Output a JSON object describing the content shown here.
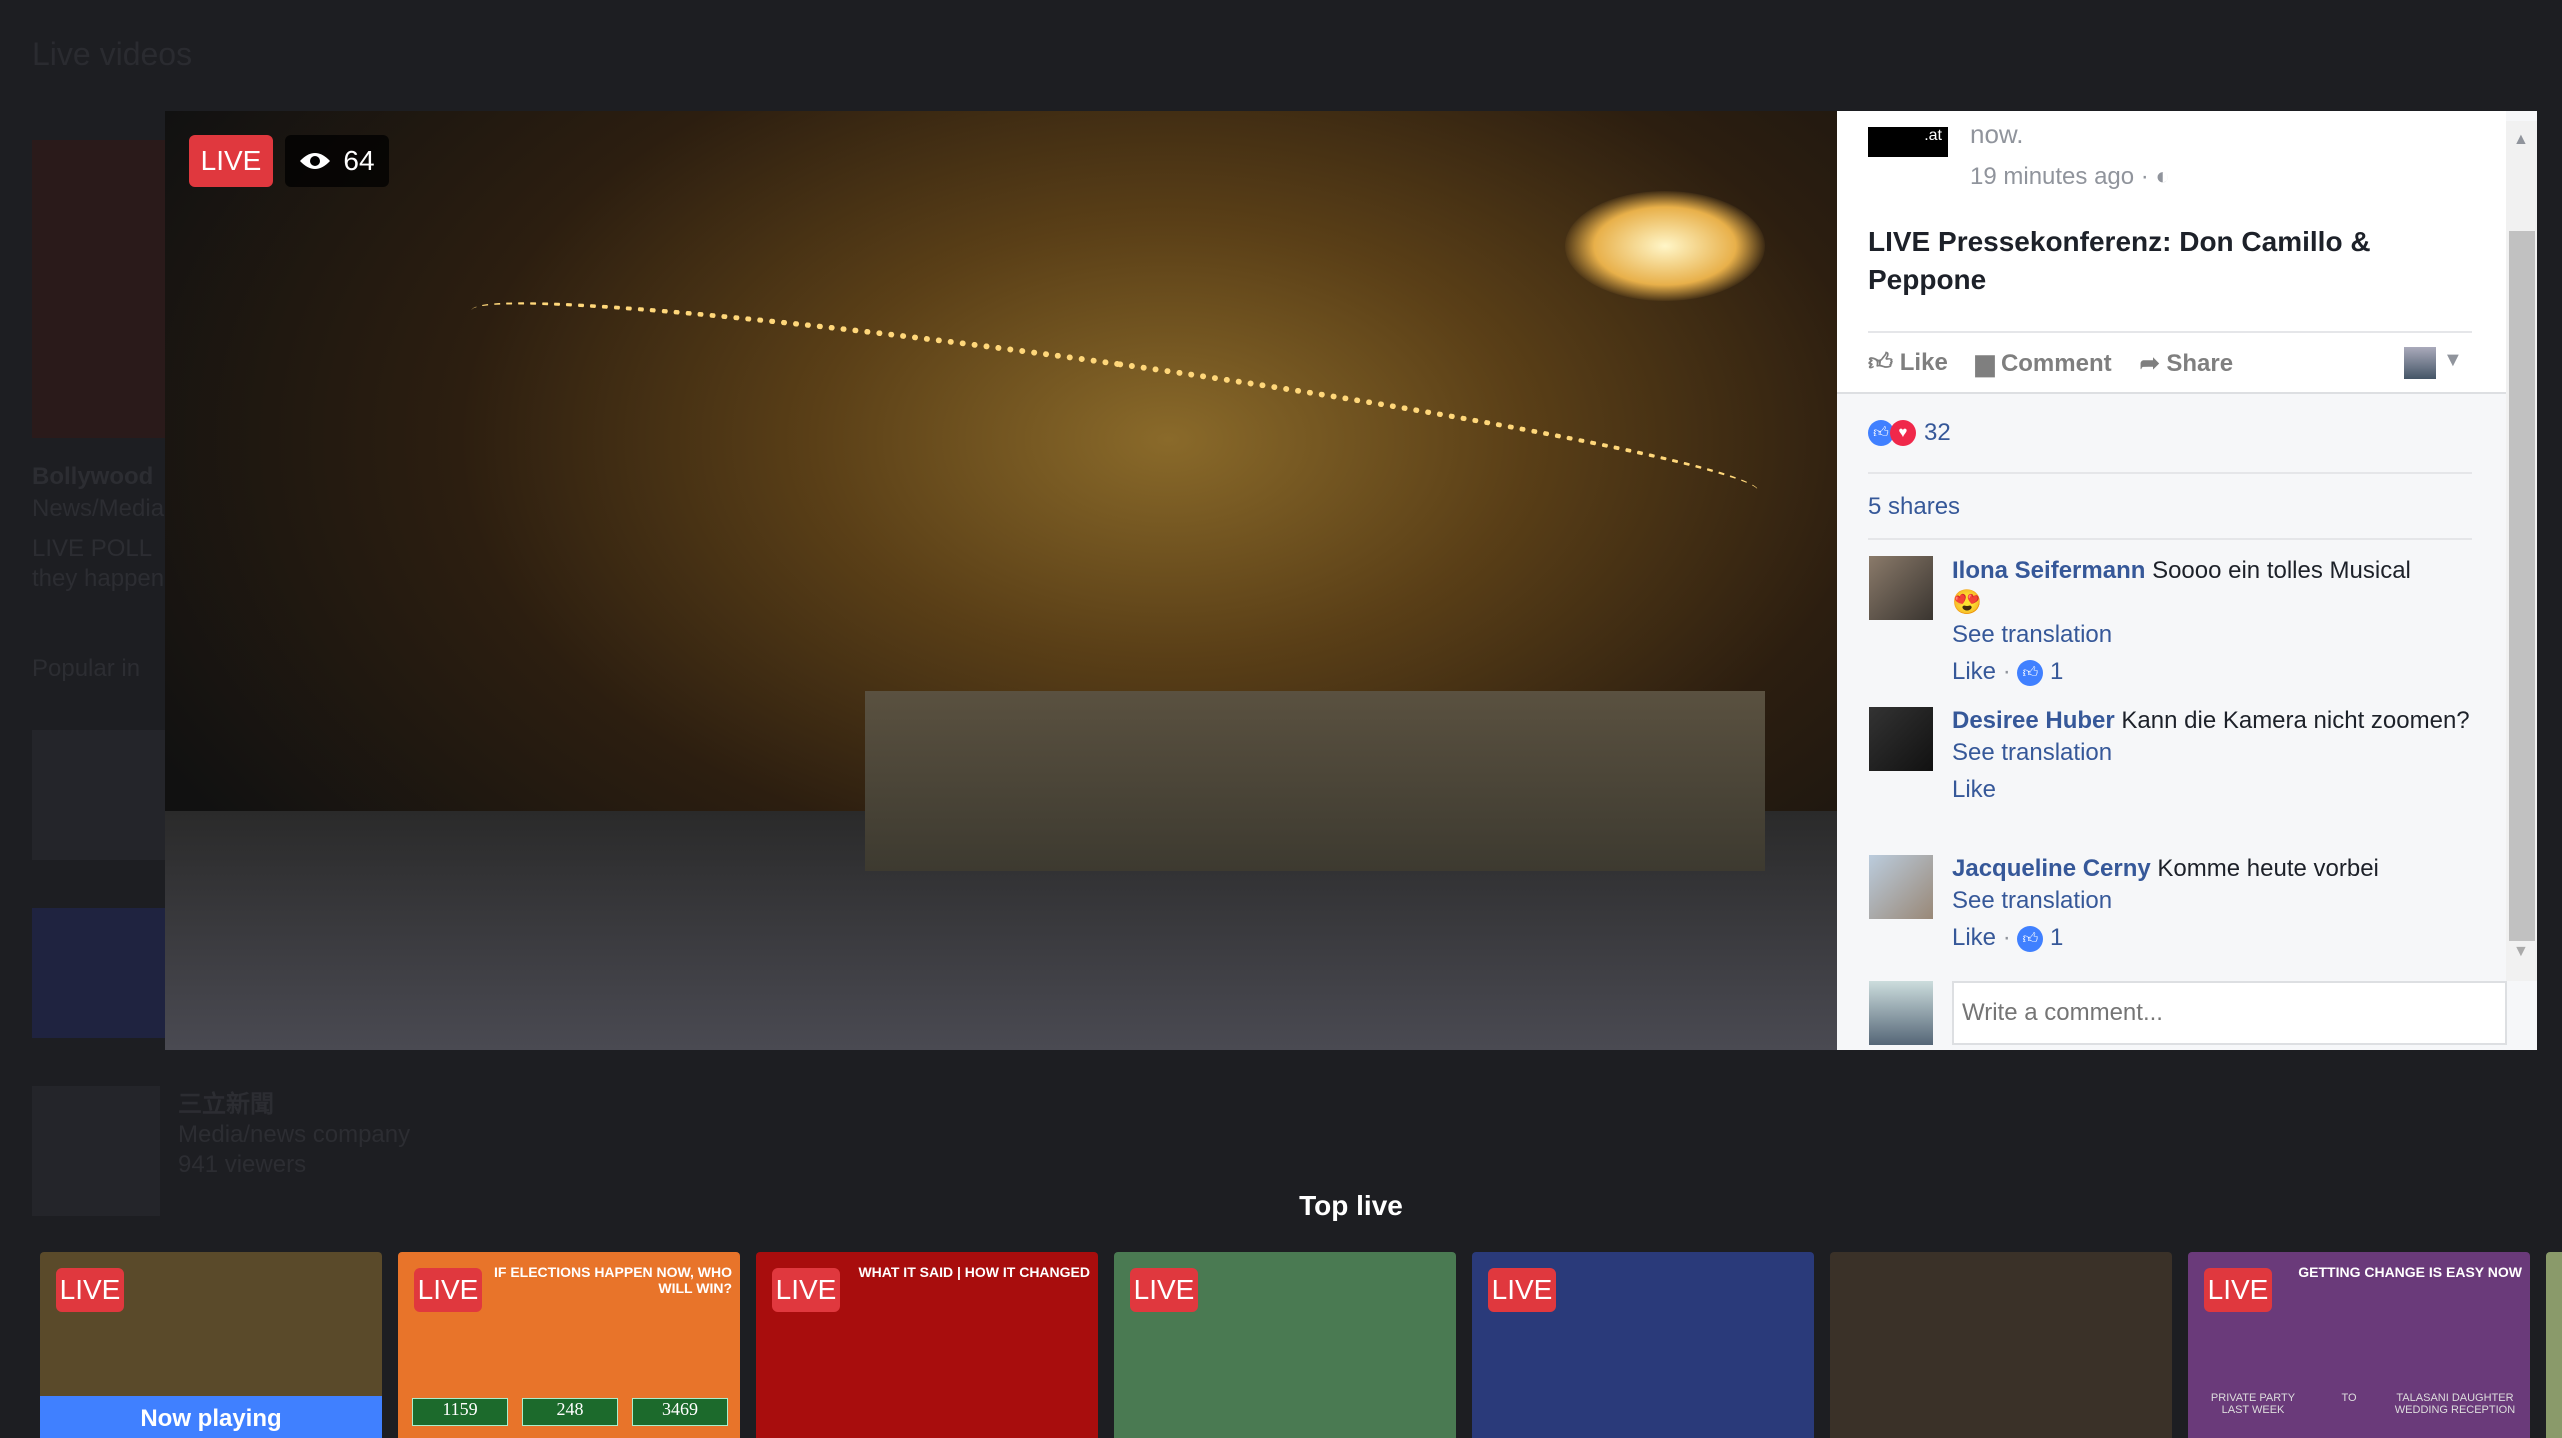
{
  "background": {
    "title": "Live videos",
    "items": [
      {
        "title": "Bollywood",
        "category": "News/Media",
        "desc1": "LIVE POLL",
        "desc2": "they happen"
      },
      {
        "title": "Popular in"
      },
      {
        "title": "三立新聞",
        "category": "Media/news company",
        "viewers": "941 viewers"
      }
    ]
  },
  "video": {
    "live_label": "LIVE",
    "viewer_count": "64",
    "icon": "eye-icon"
  },
  "post": {
    "page_logo_text": ".at",
    "time_top": "now.",
    "timestamp": "19 minutes ago",
    "privacy_icon": "globe-icon",
    "title": "LIVE Pressekonferenz: Don Camillo & Peppone",
    "actions": {
      "like": "Like",
      "comment": "Comment",
      "share": "Share"
    },
    "reactions_count": "32",
    "shares": "5 shares",
    "comments": [
      {
        "name": "Ilona Seifermann",
        "text": "Soooo ein tolles Musical",
        "emoji": "😍",
        "translate": "See translation",
        "like": "Like",
        "likes": "1"
      },
      {
        "name": "Desiree Huber",
        "text": "Kann die Kamera nicht zoomen?",
        "translate": "See translation",
        "like": "Like"
      },
      {
        "name": "Jacqueline Cerny",
        "text": "Komme heute vorbei",
        "translate": "See translation",
        "like": "Like",
        "likes": "1"
      }
    ],
    "comment_placeholder": "Write a comment..."
  },
  "top_live": {
    "title": "Top live",
    "cards": [
      {
        "live": "LIVE",
        "status": "Now playing",
        "bg": "#5a4a2a"
      },
      {
        "live": "LIVE",
        "headline": "IF ELECTIONS HAPPEN NOW, WHO WILL WIN?",
        "votes": [
          "1159",
          "248",
          "3469"
        ],
        "bg": "#e8742a"
      },
      {
        "live": "LIVE",
        "headline": "WHAT IT SAID | HOW IT CHANGED",
        "bg": "#a80d0d"
      },
      {
        "live": "LIVE",
        "bg": "#4a7a52"
      },
      {
        "live": "LIVE",
        "bg": "#2a3a7a"
      },
      {
        "bg": "#3a3128"
      },
      {
        "live": "LIVE",
        "headline": "GETTING CHANGE IS EASY NOW",
        "sub1": "PRIVATE PARTY LAST WEEK",
        "sub2": "TO",
        "sub3": "TALASANI DAUGHTER WEDDING RECEPTION",
        "bg": "#6a3a7a"
      }
    ]
  },
  "colors": {
    "live_red": "#e0383e",
    "link_blue": "#365899",
    "now_playing_blue": "#4080ff"
  }
}
